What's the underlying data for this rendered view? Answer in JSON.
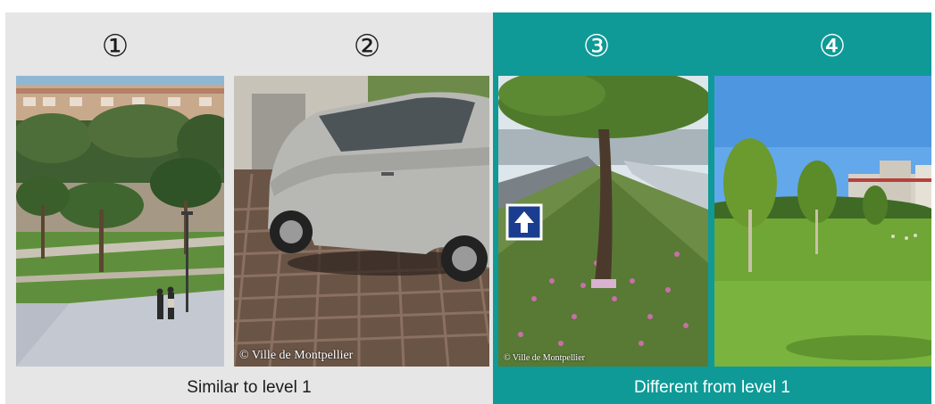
{
  "panels": [
    {
      "number": "①"
    },
    {
      "number": "②"
    },
    {
      "number": "③"
    },
    {
      "number": "④"
    }
  ],
  "captions": {
    "left": "Similar to level 1",
    "right": "Different from level 1"
  },
  "credits": {
    "photo2": "© Ville de Montpellier",
    "photo3": "© Ville de Montpellier"
  },
  "colors": {
    "left_background": "#e6e6e6",
    "right_background": "#0f9a97"
  }
}
